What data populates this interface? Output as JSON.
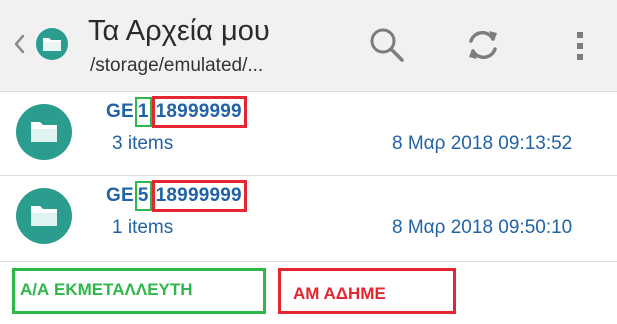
{
  "header": {
    "title": "Τα Αρχεία μου",
    "path": "/storage/emulated/...",
    "icons": {
      "back": "chevron-left-icon",
      "logo": "folder-icon",
      "search": "search-icon",
      "refresh": "refresh-icon",
      "more": "more-vert-icon"
    }
  },
  "files": [
    {
      "prefix": "GE",
      "green_part": "1",
      "red_part": "18999999",
      "count": "3 items",
      "date": "8 Μαρ 2018 09:13:52"
    },
    {
      "prefix": "GE",
      "green_part": "5",
      "red_part": "18999999",
      "count": "1 items",
      "date": "8 Μαρ 2018 09:50:10"
    }
  ],
  "legend": {
    "green_label": "Α/Α ΕΚΜΕΤΑΛΛΕΥΤΗ",
    "red_label": "ΑΜ ΑΔΗΜΕ"
  },
  "colors": {
    "accent": "#2a9d8f",
    "link_text": "#2163a6",
    "highlight_green": "#2fb84a",
    "highlight_red": "#e3262f",
    "appbar_bg": "#f1f1f1"
  }
}
